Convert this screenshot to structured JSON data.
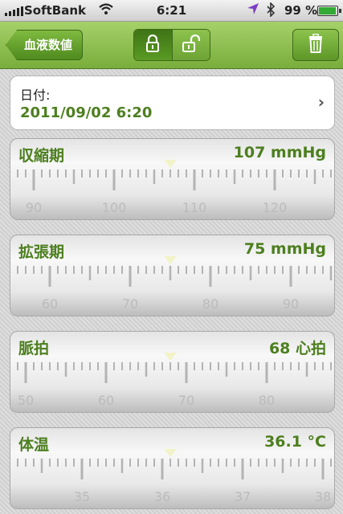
{
  "status": {
    "carrier": "SoftBank",
    "time": "6:21",
    "battery": "99 %",
    "battery_level": 0.99
  },
  "nav": {
    "back_label": "血液数値",
    "icons": [
      "lock-closed-icon",
      "lock-open-icon",
      "trash-icon"
    ]
  },
  "date": {
    "label": "日付:",
    "value": "2011/09/02 6:20"
  },
  "panels": [
    {
      "name": "収縮期",
      "value": "107 mmHg",
      "current": 107,
      "step": 1,
      "labels": [
        "90",
        "100",
        "110",
        "120"
      ]
    },
    {
      "name": "拡張期",
      "value": "75 mmHg",
      "current": 75,
      "step": 1,
      "labels": [
        "60",
        "70",
        "80",
        "90"
      ]
    },
    {
      "name": "脈拍",
      "value": "68 心拍",
      "current": 68,
      "step": 1,
      "labels": [
        "50",
        "60",
        "70",
        "80"
      ]
    },
    {
      "name": "体温",
      "value": "36.1 °C",
      "current": 36.1,
      "step": 0.1,
      "labels": [
        "35",
        "36",
        "37",
        "38"
      ]
    }
  ],
  "colors": {
    "accent": "#4d7f1f",
    "nav": "#8cc34e"
  }
}
